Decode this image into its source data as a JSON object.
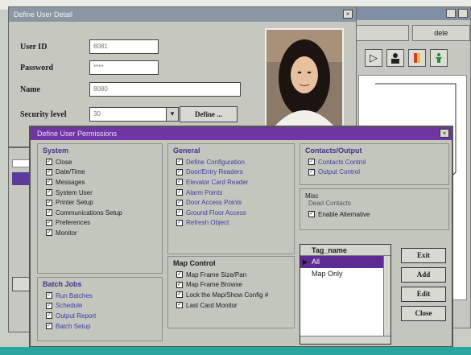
{
  "back_window": {
    "tabs": [
      "",
      "dele"
    ],
    "tool_icons": [
      "play-icon",
      "user-icon",
      "book-icon",
      "person-icon"
    ]
  },
  "main_window": {
    "title": "Define User Detail",
    "fields": {
      "user_id": {
        "label": "User ID",
        "value": "8081"
      },
      "password": {
        "label": "Password",
        "value": "****"
      },
      "name": {
        "label": "Name",
        "value": "8080"
      },
      "security_level": {
        "label": "Security level",
        "value": "30"
      }
    },
    "define_button": "Define ..."
  },
  "dialog": {
    "title": "Define User Permissions",
    "system": {
      "title": "System",
      "items": [
        "Close",
        "Date/Time",
        "Messages",
        "System User",
        "Printer Setup",
        "Communications Setup",
        "Preferences",
        "Monitor"
      ]
    },
    "general": {
      "title": "General",
      "items": [
        "Define Configuration",
        "Door/Entry Readers",
        "Elevator Card Reader",
        "Alarm Points",
        "Door Access Points",
        "Ground Floor Access",
        "Refresh Object"
      ]
    },
    "map_control": {
      "title": "Map Control",
      "items": [
        "Map Frame Size/Pan",
        "Map Frame Browse",
        "Lock the Map/Show Config #",
        "Last Card Monitor"
      ]
    },
    "batch": {
      "title": "Batch Jobs",
      "items": [
        "Run Batches",
        "Schedule",
        "Output Report",
        "Batch Setup"
      ]
    },
    "contacts": {
      "title": "Contacts/Output",
      "items": [
        "Contacts Control",
        "Output Control"
      ]
    },
    "misc": {
      "label": "Misc",
      "sub": "Dead Contacts",
      "checkbox": "Enable Alternative"
    },
    "list": {
      "header": "Tag_name",
      "rows": [
        "All",
        "Map Only"
      ]
    },
    "buttons": [
      "Exit",
      "Add",
      "Edit",
      "Close"
    ]
  }
}
